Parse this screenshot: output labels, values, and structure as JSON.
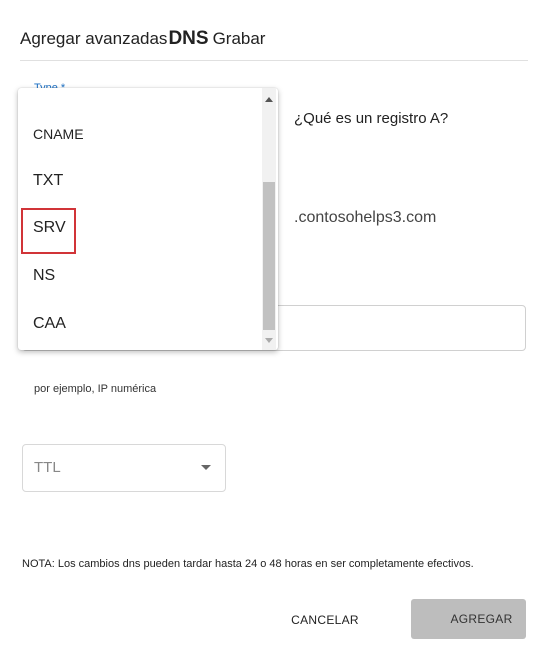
{
  "dialog": {
    "title_prefix": "Agregar avanzadas",
    "title_dns": "DNS",
    "title_suffix": "Grabar"
  },
  "type_field": {
    "label": "Type *",
    "dropdown_options": [
      "CNAME",
      "TXT",
      "SRV",
      "NS",
      "CAA"
    ],
    "highlighted_option": "SRV"
  },
  "help": {
    "link_text": "¿Qué es un registro A?"
  },
  "host": {
    "domain_suffix": ".contosohelps3.com"
  },
  "value": {
    "hint": "por ejemplo, IP numérica"
  },
  "ttl": {
    "placeholder": "TTL"
  },
  "note": "NOTA: Los cambios dns pueden tardar hasta 24 o 48 horas en ser completamente efectivos.",
  "buttons": {
    "cancel": "CANCELAR",
    "add": "AGREGAR"
  },
  "colors": {
    "accent": "#1a6fc4",
    "highlight_border": "#d13438",
    "disabled_button": "#bdbdbd"
  }
}
